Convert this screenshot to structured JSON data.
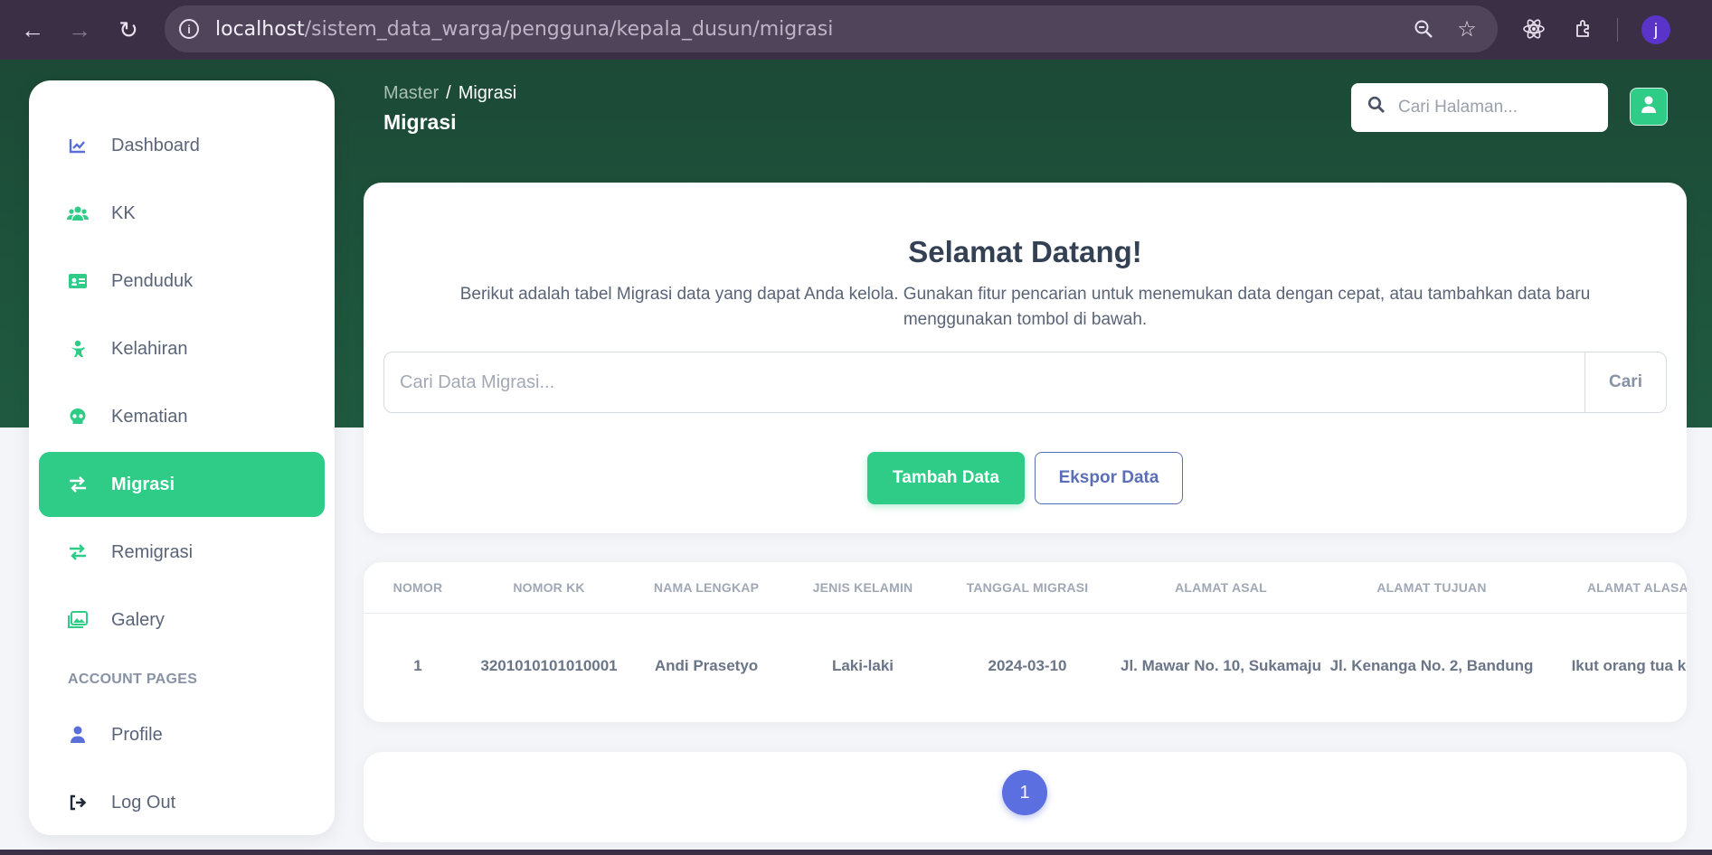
{
  "browser": {
    "url_host": "localhost",
    "url_path": "/sistem_data_warga/pengguna/kepala_dusun/migrasi",
    "profile_initial": "j"
  },
  "sidebar": {
    "items": [
      {
        "label": "Dashboard",
        "icon": "chart-icon"
      },
      {
        "label": "KK",
        "icon": "users-icon"
      },
      {
        "label": "Penduduk",
        "icon": "id-card-icon"
      },
      {
        "label": "Kelahiran",
        "icon": "baby-icon"
      },
      {
        "label": "Kematian",
        "icon": "skull-icon"
      },
      {
        "label": "Migrasi",
        "icon": "exchange-icon",
        "active": true
      },
      {
        "label": "Remigrasi",
        "icon": "exchange-icon"
      },
      {
        "label": "Galery",
        "icon": "images-icon"
      }
    ],
    "section_label": "ACCOUNT PAGES",
    "account_items": [
      {
        "label": "Profile",
        "icon": "user-icon"
      },
      {
        "label": "Log Out",
        "icon": "logout-icon"
      }
    ]
  },
  "header": {
    "breadcrumb_parent": "Master",
    "breadcrumb_separator": "/",
    "breadcrumb_current": "Migrasi",
    "page_title": "Migrasi",
    "search_placeholder": "Cari Halaman..."
  },
  "welcome": {
    "title": "Selamat Datang!",
    "description": "Berikut adalah tabel Migrasi data yang dapat Anda kelola. Gunakan fitur pencarian untuk menemukan data dengan cepat, atau tambahkan data baru menggunakan tombol di bawah.",
    "search_placeholder": "Cari Data Migrasi...",
    "search_button": "Cari",
    "add_button": "Tambah Data",
    "export_button": "Ekspor Data"
  },
  "table": {
    "columns": [
      "NOMOR",
      "NOMOR KK",
      "NAMA LENGKAP",
      "JENIS KELAMIN",
      "TANGGAL MIGRASI",
      "ALAMAT ASAL",
      "ALAMAT TUJUAN",
      "ALAMAT ALASAN"
    ],
    "rows": [
      [
        "1",
        "3201010101010001",
        "Andi Prasetyo",
        "Laki-laki",
        "2024-03-10",
        "Jl. Mawar No. 10, Sukamaju",
        "Jl. Kenanga No. 2, Bandung",
        "Ikut orang tua kerja"
      ]
    ]
  },
  "pagination": {
    "current_page": "1"
  },
  "colors": {
    "accent_green": "#2ecc87",
    "hero_green": "#1f5a40",
    "pager_blue": "#5b6fe0",
    "chrome_bg": "#3a2f45"
  }
}
